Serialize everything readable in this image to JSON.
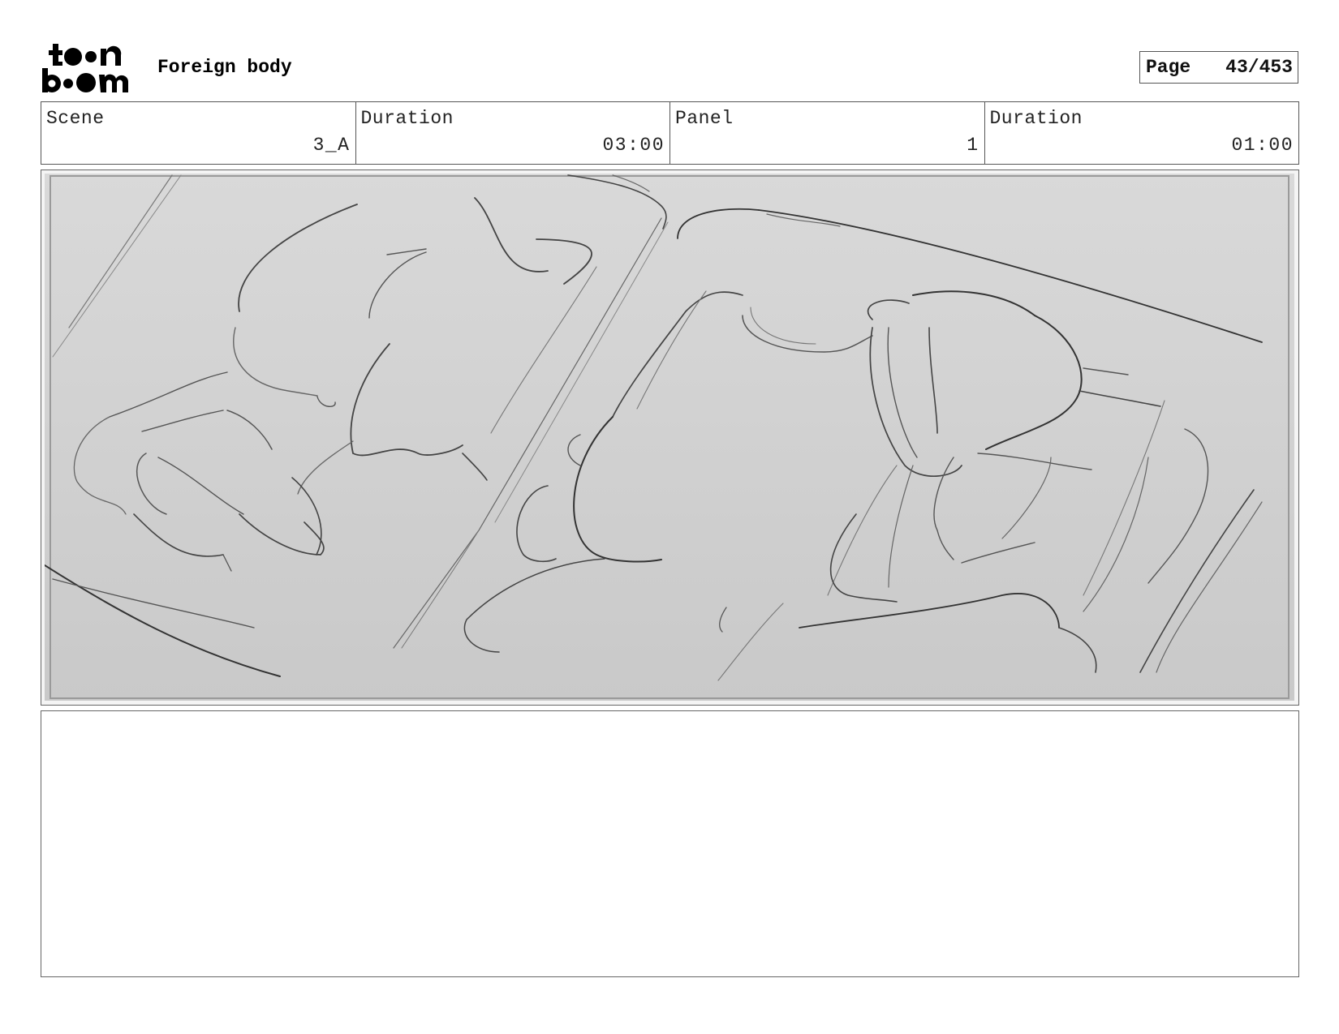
{
  "header": {
    "logo_text": "toon boom",
    "project_title": "Foreign body",
    "page_label": "Page",
    "page_number": "43/453"
  },
  "info": [
    {
      "label": "Scene",
      "value": "3_A"
    },
    {
      "label": "Duration",
      "value": "03:00"
    },
    {
      "label": "Panel",
      "value": "1"
    },
    {
      "label": "Duration",
      "value": "01:00"
    }
  ],
  "panel": {
    "image": "storyboard-sketch"
  },
  "notes": {
    "text": ""
  }
}
